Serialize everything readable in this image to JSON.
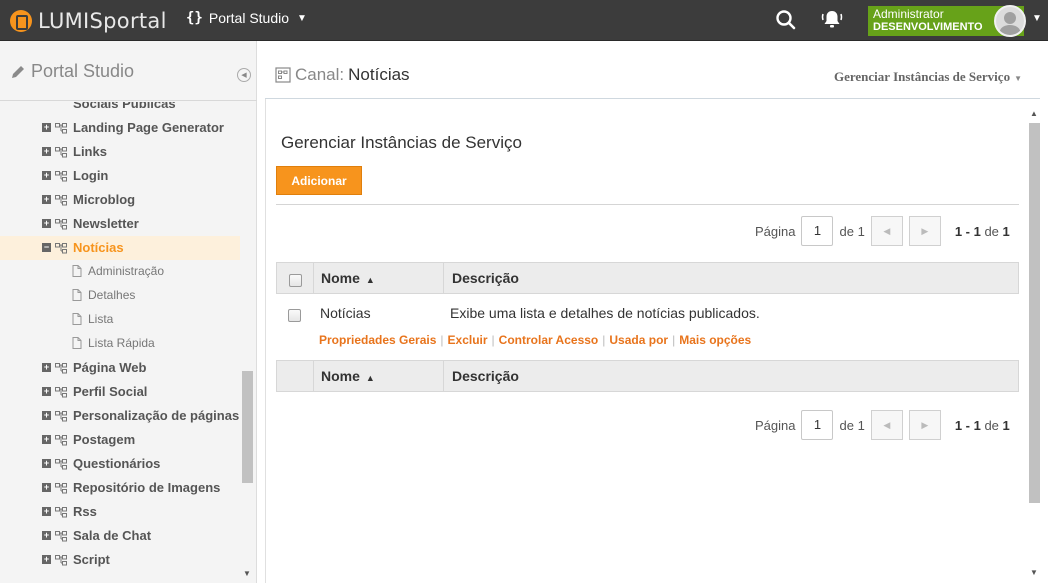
{
  "topbar": {
    "logo_text": "LUMISportal",
    "studio_label": "Portal Studio",
    "user_name": "Administrator",
    "user_env": "DESENVOLVIMENTO"
  },
  "sidebar": {
    "title": "Portal Studio",
    "items": [
      {
        "label": "Sociais Públicas",
        "type": "partial"
      },
      {
        "label": "Landing Page Generator",
        "type": "node"
      },
      {
        "label": "Links",
        "type": "node"
      },
      {
        "label": "Login",
        "type": "node"
      },
      {
        "label": "Microblog",
        "type": "node"
      },
      {
        "label": "Newsletter",
        "type": "node"
      },
      {
        "label": "Notícias",
        "type": "node",
        "active": true
      },
      {
        "label": "Administração",
        "type": "child"
      },
      {
        "label": "Detalhes",
        "type": "child"
      },
      {
        "label": "Lista",
        "type": "child"
      },
      {
        "label": "Lista Rápida",
        "type": "child"
      },
      {
        "label": "Página Web",
        "type": "node"
      },
      {
        "label": "Perfil Social",
        "type": "node"
      },
      {
        "label": "Personalização de páginas",
        "type": "node"
      },
      {
        "label": "Postagem",
        "type": "node"
      },
      {
        "label": "Questionários",
        "type": "node"
      },
      {
        "label": "Repositório de Imagens",
        "type": "node"
      },
      {
        "label": "Rss",
        "type": "node"
      },
      {
        "label": "Sala de Chat",
        "type": "node"
      },
      {
        "label": "Script",
        "type": "node"
      }
    ]
  },
  "canal": {
    "prefix": "Canal:",
    "name": "Notícias",
    "action_label": "Gerenciar Instâncias de Serviço"
  },
  "content": {
    "section_title": "Gerenciar Instâncias de Serviço",
    "add_label": "Adicionar",
    "pager": {
      "label": "Página",
      "current": "1",
      "of_label": "de",
      "of_total": "1",
      "range": "1 - 1",
      "range_of": "de",
      "range_total": "1"
    },
    "columns": {
      "name": "Nome",
      "description": "Descrição"
    },
    "rows": [
      {
        "name": "Notícias",
        "description": "Exibe uma lista e detalhes de notícias publicados.",
        "actions": [
          "Propriedades Gerais",
          "Excluir",
          "Controlar Acesso",
          "Usada por",
          "Mais opções"
        ]
      }
    ]
  },
  "colors": {
    "accent": "#f7941d",
    "user_green": "#67a219",
    "topbar": "#3c3c3c"
  }
}
